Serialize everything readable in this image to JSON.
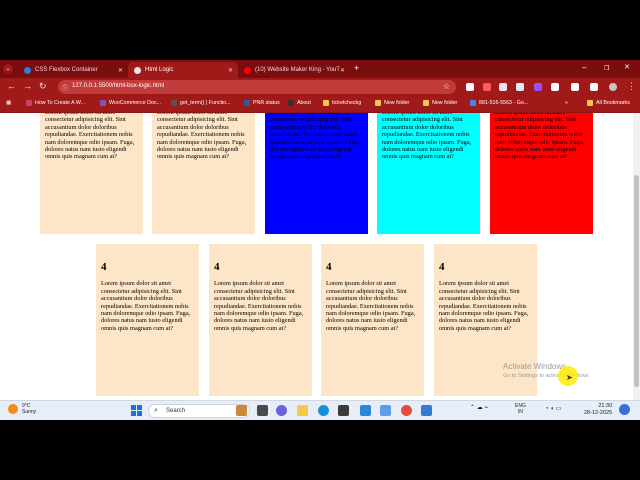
{
  "browser": {
    "tabs": [
      {
        "label": "CSS Flexbox Container",
        "icon_color": "#2a7de1"
      },
      {
        "label": "Html Logic",
        "icon_color": "#e8e8e8"
      },
      {
        "label": "(10) Website Maker King - YouT",
        "icon_color": "#ff0000"
      }
    ],
    "active_tab_index": 1,
    "url": "127.0.0.1:5500/html-box-logic.html",
    "bookmarks": [
      {
        "label": "How To Create A W...",
        "color": "#d0405d"
      },
      {
        "label": "WooCommerce Doc...",
        "color": "#7f54b3"
      },
      {
        "label": "get_term() | Functio...",
        "color": "#555555"
      },
      {
        "label": "PNR status",
        "color": "#2c5aa0"
      },
      {
        "label": "About",
        "color": "#333333"
      },
      {
        "label": "ticketcheckg",
        "color": "#f2c94c"
      },
      {
        "label": "New folder",
        "color": "#f2c94c"
      },
      {
        "label": "New folder",
        "color": "#f2c94c"
      },
      {
        "label": "881-516-5563 - Go...",
        "color": "#4285f4"
      },
      {
        "label": "All Bookmarks",
        "color": "#f2c94c"
      }
    ]
  },
  "page": {
    "lorem": "Lorem ipsum dolor sit amet consectetur adipisicing elit. Sint accusantium dolor doloribus repudiandae. Exercitationem nobis nam doloremque odio ipsam. Fuga, dolores natus nam iusto eligendi omnis quis magnam cum at?",
    "row1_boxes": [
      {
        "color": "#fde5c7",
        "text": "Lorem ipsum dolor sit amet consectetur adipisicing elit. Sint accusantium dolor doloribus repudiandae. Exercitationem nobis nam doloremque odio ipsam. Fuga, dolores natus nam iusto eligendi omnis quis magnam cum at?"
      },
      {
        "color": "#fde5c7",
        "text": "Lorem ipsum dolor sit amet consectetur adipisicing elit. Sint accusantium dolor doloribus repudiandae. Exercitationem nobis nam doloremque odio ipsam. Fuga, dolores natus nam iusto eligendi omnis quis magnam cum at?"
      },
      {
        "color": "#0000ff",
        "text": "Lorem ipsum dolor sit amet consectetur adipisicing elit. Sint accusantium dolor doloribus repudiandae. Exercitationem nobis nam doloremque odio ipsam. Fuga, dolores natus nam iusto eligendi omnis quis magnam cum at?"
      },
      {
        "color": "#00ffff",
        "text": "Lorem ipsum dolor sit amet consectetur adipisicing elit. Sint accusantium dolor doloribus repudiandae. Exercitationem nobis nam doloremque odio ipsam. Fuga, dolores natus nam iusto eligendi omnis quis magnam cum at?"
      },
      {
        "color": "#ff0000",
        "text": "Lorem ipsum dolor sit amet consectetur adipisicing elit. Sint accusantium dolor doloribus repudiandae. Exercitationem nobis nam doloremque odio ipsam. Fuga, dolores natus nam iusto eligendi omnis quis magnam cum at?"
      }
    ],
    "row2_boxes": [
      {
        "color": "#fde5c7",
        "heading": "4",
        "text": "Lorem ipsum dolor sit amet consectetur adipisicing elit. Sint accusantium dolor doloribus repudiandae. Exercitationem nobis nam doloremque odio ipsam. Fuga, dolores natus nam iusto eligendi omnis quis magnam cum at?"
      },
      {
        "color": "#fde5c7",
        "heading": "4",
        "text": "Lorem ipsum dolor sit amet consectetur adipisicing elit. Sint accusantium dolor doloribus repudiandae. Exercitationem nobis nam doloremque odio ipsam. Fuga, dolores natus nam iusto eligendi omnis quis magnam cum at?"
      },
      {
        "color": "#fde5c7",
        "heading": "4",
        "text": "Lorem ipsum dolor sit amet consectetur adipisicing elit. Sint accusantium dolor doloribus repudiandae. Exercitationem nobis nam doloremque odio ipsam. Fuga, dolores natus nam iusto eligendi omnis quis magnam cum at?"
      },
      {
        "color": "#fde5c7",
        "heading": "4",
        "text": "Lorem ipsum dolor sit amet consectetur adipisicing elit. Sint accusantium dolor doloribus repudiandae. Exercitationem nobis nam doloremque odio ipsam. Fuga, dolores natus nam iusto eligendi omnis quis magnam cum at?"
      }
    ],
    "watermark_title": "Activate Windows",
    "watermark_sub": "Go to Settings to activate Windows."
  },
  "taskbar": {
    "weather_temp": "9°C",
    "weather_desc": "Sunny",
    "search_label": "Search",
    "lang_1": "ENG",
    "lang_2": "IN",
    "time": "21:30",
    "date": "28-12-2025"
  }
}
